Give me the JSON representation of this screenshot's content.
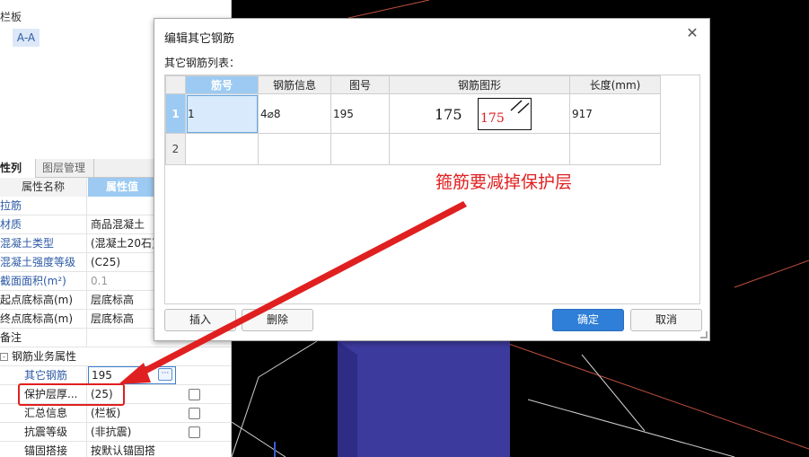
{
  "left_panel": {
    "tree_root": "栏板",
    "tree_node": "A-A",
    "tabs": [
      "性列表",
      "图层管理"
    ],
    "header": {
      "name": "属性名称",
      "value": "属性值"
    },
    "rows": [
      {
        "name": "拉筋",
        "value": ""
      },
      {
        "name": "材质",
        "value": "商品混凝土"
      },
      {
        "name": "混凝土类型",
        "value": "(混凝土20石)"
      },
      {
        "name": "混凝土强度等级",
        "value": "(C25)"
      },
      {
        "name": "截面面积(m²)",
        "value": "0.1"
      },
      {
        "name": "起点底标高(m)",
        "value": "层底标高"
      },
      {
        "name": "终点底标高(m)",
        "value": "层底标高"
      },
      {
        "name": "备注",
        "value": ""
      },
      {
        "name": "钢筋业务属性",
        "value": ""
      },
      {
        "name": "其它钢筋",
        "value": "195"
      },
      {
        "name": "保护层厚...",
        "value": "(25)"
      },
      {
        "name": "汇总信息",
        "value": "(栏板)"
      },
      {
        "name": "抗震等级",
        "value": "(非抗震)"
      },
      {
        "name": "锚固搭接",
        "value": "按默认锚固搭..."
      }
    ],
    "expander": "-",
    "dots": "···"
  },
  "dialog": {
    "title": "编辑其它钢筋",
    "close": "✕",
    "list_label": "其它钢筋列表：",
    "columns": [
      "筋号",
      "钢筋信息",
      "图号",
      "钢筋图形",
      "长度(mm)"
    ],
    "rows": [
      {
        "num": "1",
        "bar_no": "1",
        "info": "4⌀8",
        "fig": "195",
        "shape_left": "175",
        "shape_box": "175",
        "length": "917"
      },
      {
        "num": "2",
        "bar_no": "",
        "info": "",
        "fig": "",
        "shape_left": "",
        "shape_box": "",
        "length": ""
      }
    ],
    "buttons": {
      "insert": "插入",
      "delete": "删除",
      "ok": "确定",
      "cancel": "取消"
    }
  },
  "annotation": "箍筋要减掉保护层",
  "colors": {
    "accent": "#2f7fd8",
    "header_active": "#9ccaf2",
    "annotation": "#e02020",
    "scene_block": "#3d3a9e"
  }
}
